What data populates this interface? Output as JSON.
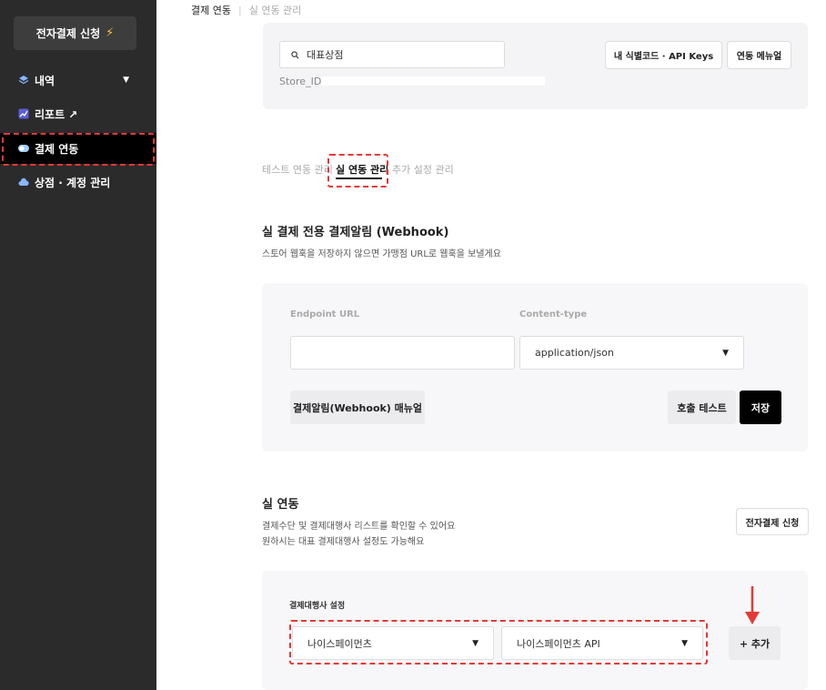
{
  "sidebar": {
    "apply_button": "전자결제 신청",
    "items": [
      {
        "label": "내역",
        "icon": "layers-icon"
      },
      {
        "label": "리포트 ↗",
        "icon": "chart-icon"
      },
      {
        "label": "결제 연동",
        "icon": "toggle-icon"
      },
      {
        "label": "상점 · 계정 관리",
        "icon": "cloud-icon"
      }
    ]
  },
  "breadcrumb": {
    "current": "결제 연동",
    "sub": "실 연동 관리"
  },
  "store": {
    "search_value": "대표상점",
    "store_id_label": "Store_ID",
    "id_keys_button": "내 식별코드 · API Keys",
    "manual_button": "연동 메뉴얼"
  },
  "tabs": [
    "테스트 연동 관리",
    "실 연동 관리",
    "추가 설정 관리"
  ],
  "webhook": {
    "title": "실 결제 전용 결제알림 (Webhook)",
    "desc": "스토어 웹훅을 저장하지 않으면 가맹점 URL로 웹훅을 보낼게요",
    "endpoint_label": "Endpoint URL",
    "endpoint_value": "",
    "content_type_label": "Content-type",
    "content_type_value": "application/json",
    "manual_button": "결제알림(Webhook) 매뉴얼",
    "test_button": "호출 테스트",
    "save_button": "저장"
  },
  "integration": {
    "title": "실 연동",
    "desc_line1": "결제수단 및 결제대행사 리스트를 확인할 수 있어요",
    "desc_line2": "원하시는 대표 결제대행사 설정도 가능해요",
    "apply_button": "전자결제 신청",
    "pg_setting_label": "결제대행사 설정",
    "pg_select": "나이스페이먼츠",
    "pg_api_select": "나이스페이먼츠 API",
    "add_button": "+ 추가"
  },
  "colors": {
    "sidebar_bg": "#2b2b2b",
    "highlight": "#e53935",
    "accent_bolt": "#f6c343"
  }
}
